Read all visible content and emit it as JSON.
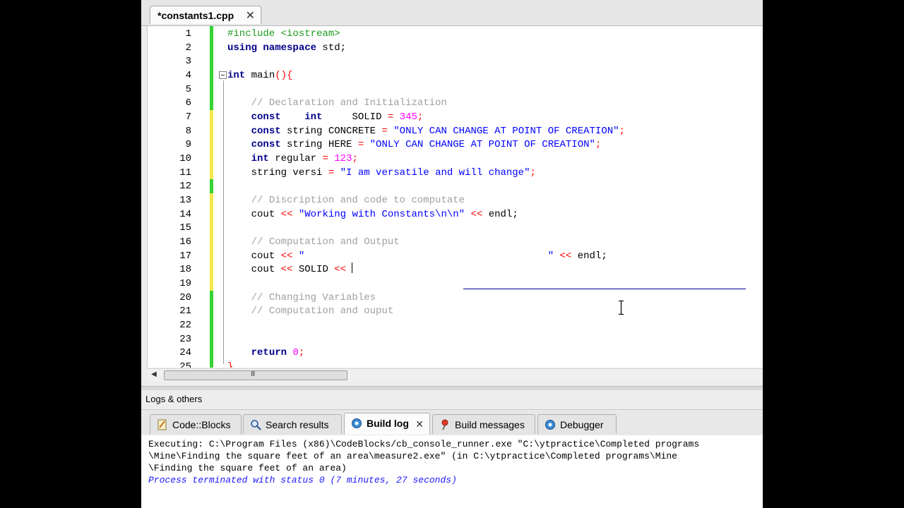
{
  "editor_tab": {
    "label": "*constants1.cpp",
    "close": "✕"
  },
  "gutter": {
    "lines": [
      "1",
      "2",
      "3",
      "4",
      "5",
      "6",
      "7",
      "8",
      "9",
      "10",
      "11",
      "12",
      "13",
      "14",
      "15",
      "16",
      "17",
      "18",
      "19",
      "20",
      "21",
      "22",
      "23",
      "24",
      "25"
    ]
  },
  "code": {
    "l1_pp": "#include <iostream>",
    "l2_kw": "using namespace",
    "l2_rest": " std;",
    "l4_kw": "int",
    "l4_rest": " main",
    "l4_br": "(){",
    "l6": "// Declaration and Initialization",
    "l7_kw1": "const",
    "l7_kw2": "int",
    "l7_id": "SOLID",
    "l7_op": "=",
    "l7_num": "345",
    "l7_end": ";",
    "l8_kw": "const",
    "l8_id": " string CONCRETE ",
    "l8_op": "=",
    "l8_str": "\"ONLY CAN CHANGE AT POINT OF CREATION\"",
    "l8_end": ";",
    "l9_kw": "const",
    "l9_id": " string HERE ",
    "l9_op": "=",
    "l9_str": "\"ONLY CAN CHANGE AT POINT OF CREATION\"",
    "l9_end": ";",
    "l10_kw": "int",
    "l10_id": " regular ",
    "l10_op": "=",
    "l10_num": "123",
    "l10_end": ";",
    "l11_id": "string versi ",
    "l11_op": "=",
    "l11_str": "\"I am versatile and will change\"",
    "l11_end": ";",
    "l13": "// Discription and code to computate",
    "l14_id": "cout ",
    "l14_op": "<<",
    "l14_str": "\"Working with Constants\\n\\n\"",
    "l14_op2": "<<",
    "l14_end": " endl;",
    "l16": "// Computation and Output",
    "l17_id": "cout ",
    "l17_op": "<<",
    "l17_str_open": "\"",
    "l17_str_close": "\"",
    "l17_op2": "<<",
    "l17_end": " endl;",
    "l18_id": "cout ",
    "l18_op": "<<",
    "l18_mid": " SOLID ",
    "l18_op2": "<<",
    "l20": "// Changing Variables",
    "l21": "// Computation and ouput",
    "l24_kw": "return",
    "l24_num": "0",
    "l24_end": ";",
    "l25_br": "}"
  },
  "scrollbar": {
    "left_arrow": "◀",
    "grip": "III"
  },
  "panel": {
    "title": "Logs & others"
  },
  "log_tabs": [
    {
      "label": "Code::Blocks",
      "icon": "codeblocks-icon"
    },
    {
      "label": "Search results",
      "icon": "search-icon"
    },
    {
      "label": "Build log",
      "icon": "gear-icon",
      "active": true,
      "close": "✕"
    },
    {
      "label": "Build messages",
      "icon": "pin-icon"
    },
    {
      "label": "Debugger",
      "icon": "debugger-icon"
    }
  ],
  "build_log": {
    "line1": "Executing: C:\\Program Files (x86)\\CodeBlocks/cb_console_runner.exe \"C:\\ytpractice\\Completed programs",
    "line2": "\\Mine\\Finding the square feet of an area\\measure2.exe\" (in C:\\ytpractice\\Completed programs\\Mine",
    "line3": "\\Finding the square feet of an area)",
    "line4": "Process terminated with status 0 (7 minutes, 27 seconds)"
  },
  "colors": {
    "keyword": "#00008b",
    "string": "#0000ff",
    "number": "#ff00ff",
    "operator": "#ff0000",
    "comment": "#a0a0a0",
    "preprocessor": "#1e9a1e",
    "change_saved": "#35d335",
    "change_unsaved": "#f3e84a"
  }
}
